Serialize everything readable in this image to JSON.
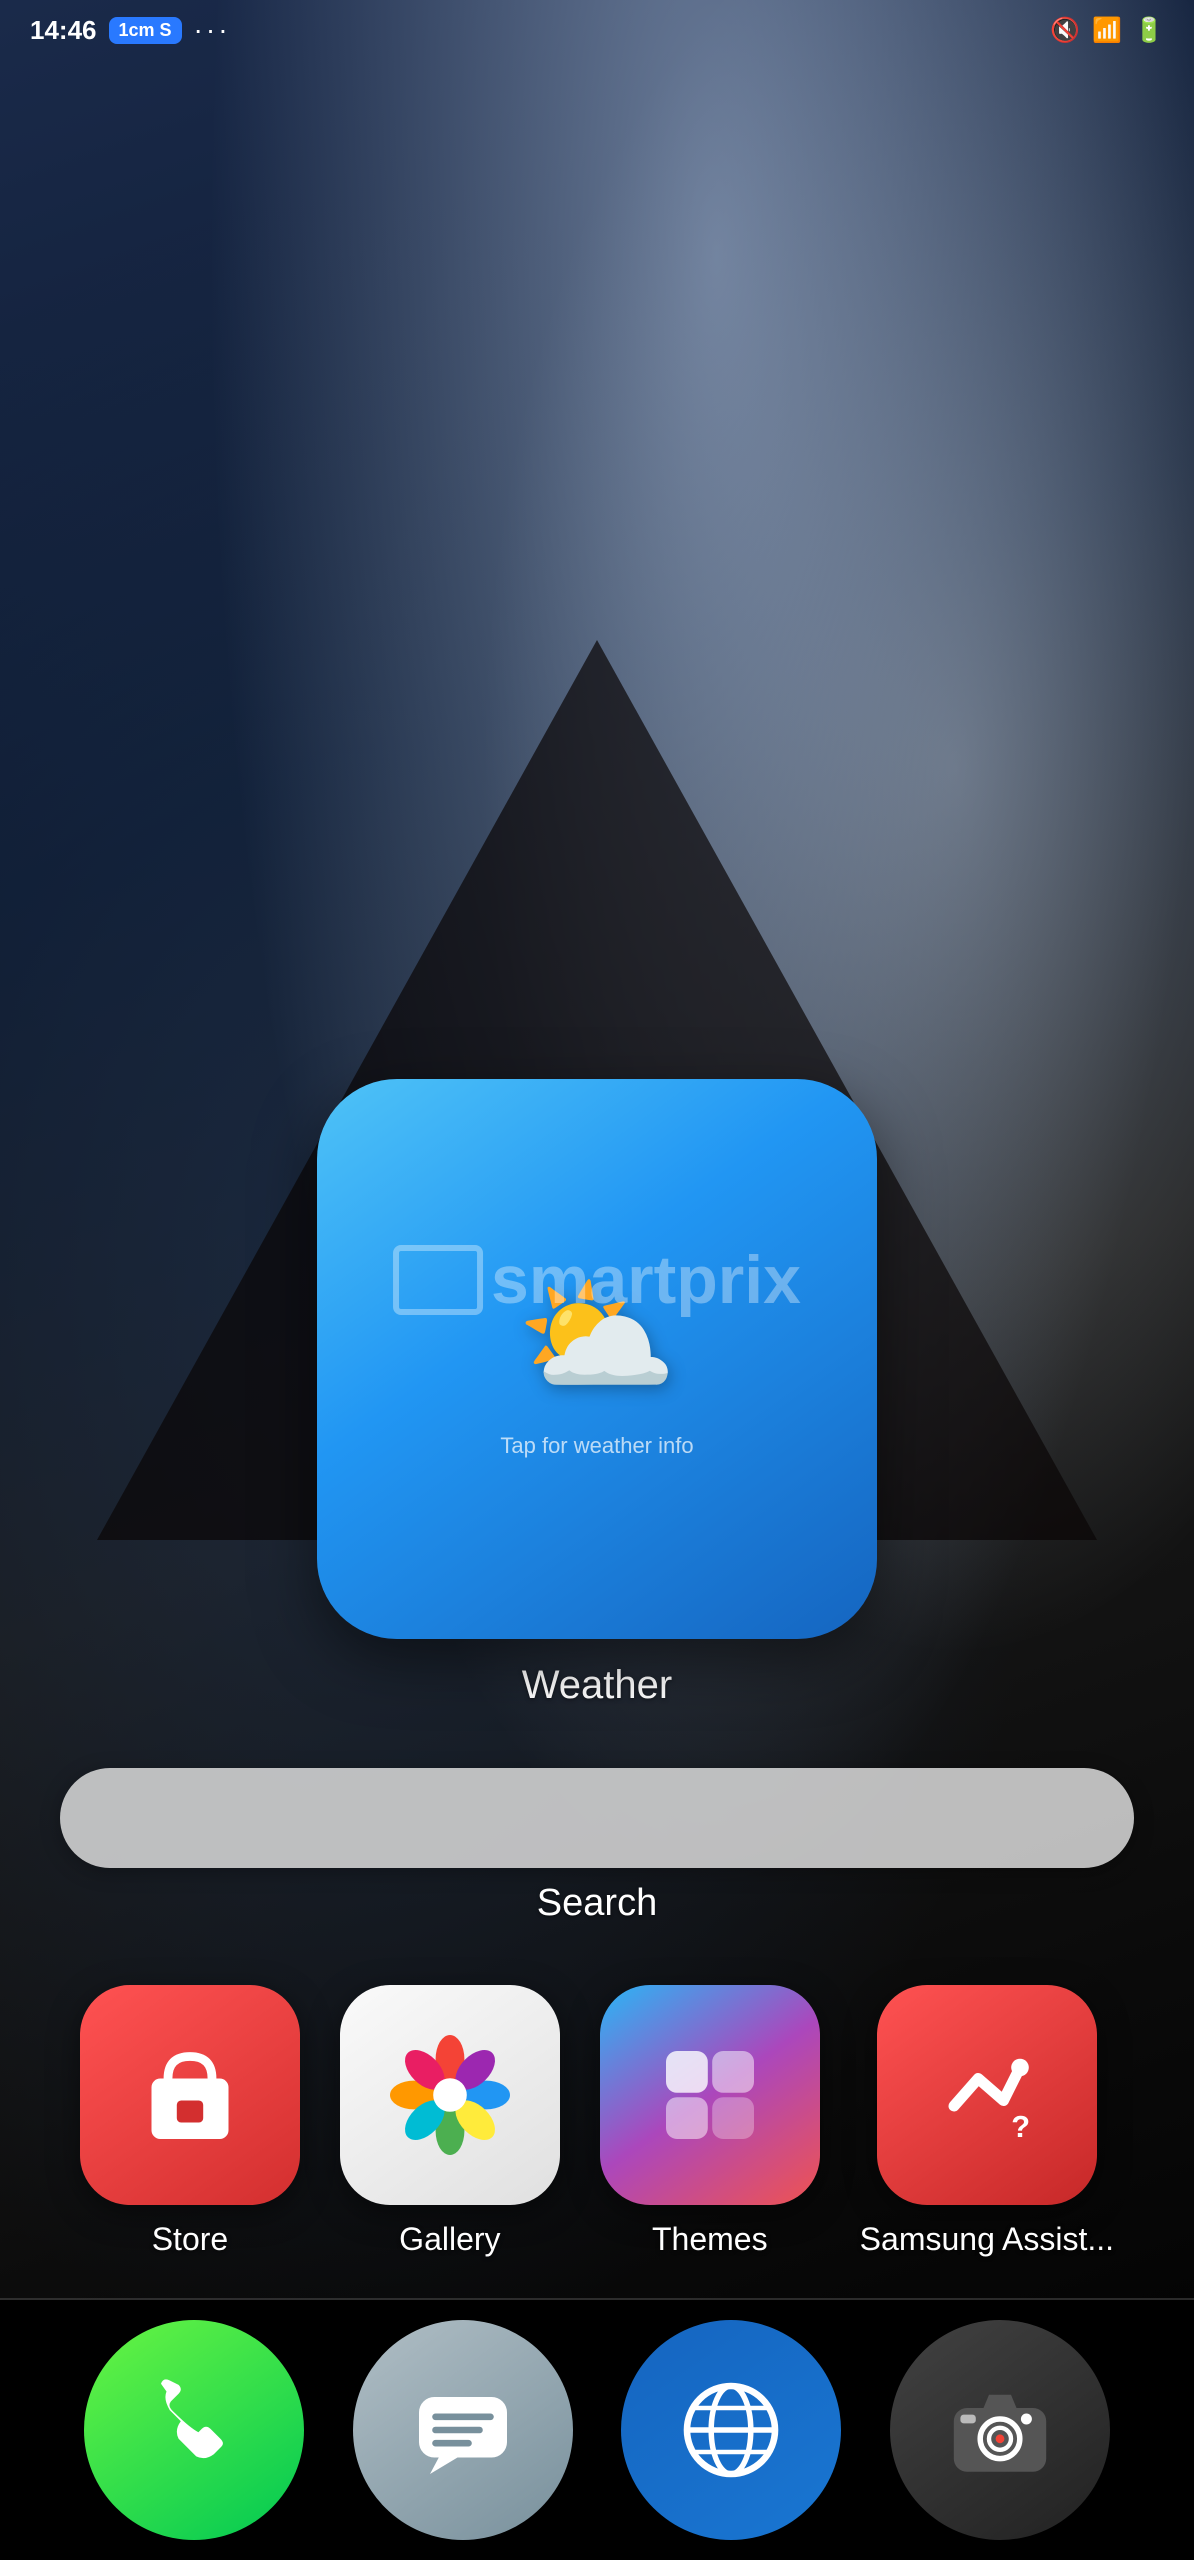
{
  "status_bar": {
    "time": "14:46",
    "network": "1cm S",
    "dots": "···"
  },
  "weather_widget": {
    "icon": "⛅",
    "tap_text": "Tap for weather info",
    "label": "Weather"
  },
  "watermark": {
    "text": "smartprix"
  },
  "search": {
    "label": "Search"
  },
  "apps": [
    {
      "id": "store",
      "label": "Store",
      "icon": "🛍"
    },
    {
      "id": "gallery",
      "label": "Gallery",
      "icon": "gallery"
    },
    {
      "id": "themes",
      "label": "Themes",
      "icon": "themes"
    },
    {
      "id": "assist",
      "label": "Samsung Assist...",
      "icon": "assist"
    }
  ],
  "nav": [
    {
      "id": "phone",
      "label": "Phone",
      "icon": "📞"
    },
    {
      "id": "messages",
      "label": "Messages",
      "icon": "💬"
    },
    {
      "id": "browser",
      "label": "Browser",
      "icon": "browser"
    },
    {
      "id": "camera",
      "label": "Camera",
      "icon": "📷"
    }
  ]
}
